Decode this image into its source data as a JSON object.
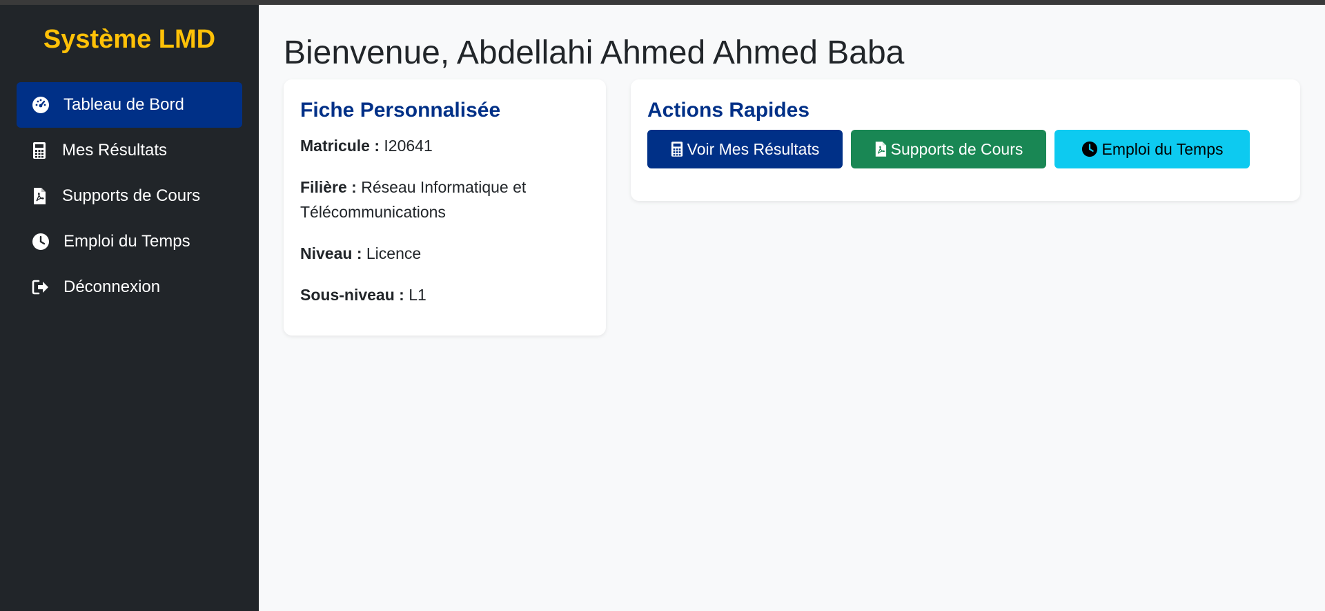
{
  "brand": "Système LMD",
  "sidebar": {
    "items": [
      {
        "label": "Tableau de Bord",
        "icon": "dashboard-gauge-icon"
      },
      {
        "label": "Mes Résultats",
        "icon": "calculator-icon"
      },
      {
        "label": "Supports de Cours",
        "icon": "pdf-file-icon"
      },
      {
        "label": "Emploi du Temps",
        "icon": "clock-icon"
      },
      {
        "label": "Déconnexion",
        "icon": "logout-icon"
      }
    ],
    "active_index": 0
  },
  "welcome": "Bienvenue, Abdellahi Ahmed Ahmed Baba",
  "profile": {
    "title": "Fiche Personnalisée",
    "matricule_label": "Matricule :",
    "matricule_value": "I20641",
    "filiere_label": "Filière :",
    "filiere_value": "Réseau Informatique et Télécommunications",
    "niveau_label": "Niveau :",
    "niveau_value": "Licence",
    "sous_niveau_label": "Sous-niveau :",
    "sous_niveau_value": "L1"
  },
  "actions": {
    "title": "Actions Rapides",
    "buttons": [
      {
        "label": "Voir Mes Résultats",
        "icon": "calculator-icon",
        "color": "#003087"
      },
      {
        "label": "Supports de Cours",
        "icon": "pdf-file-icon",
        "color": "#198754"
      },
      {
        "label": "Emploi du Temps",
        "icon": "clock-icon",
        "color": "#0dcaf0"
      }
    ]
  },
  "colors": {
    "sidebar_bg": "#212529",
    "brand": "#ffc107",
    "primary": "#003087",
    "success": "#198754",
    "info": "#0dcaf0",
    "page_bg": "#f8f9fa"
  }
}
